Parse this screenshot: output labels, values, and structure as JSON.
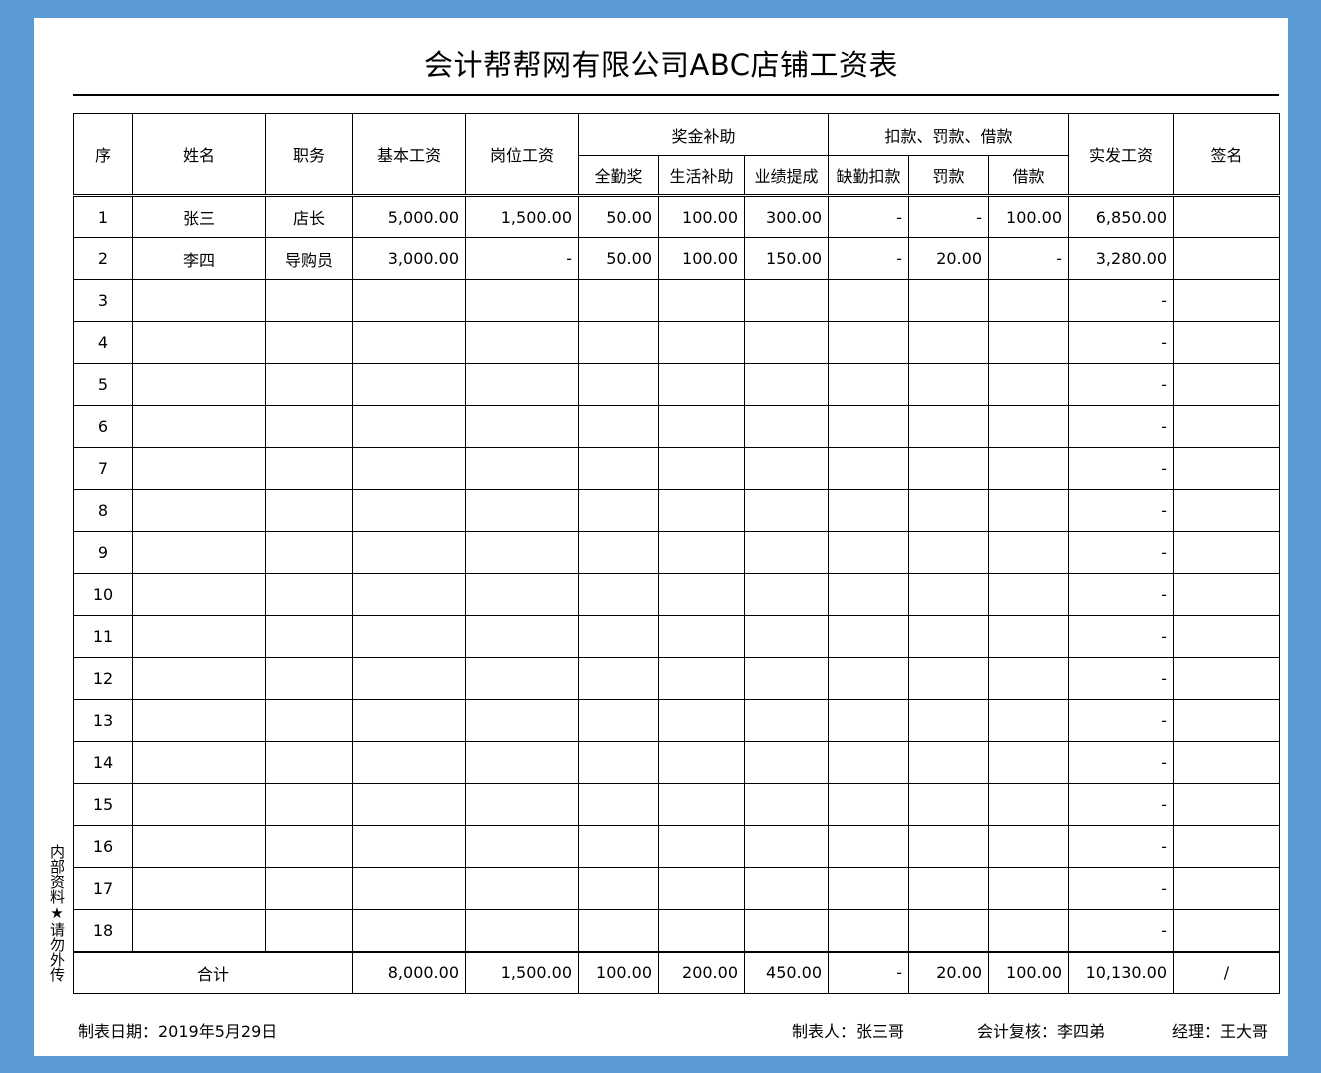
{
  "title": "会计帮帮网有限公司ABC店铺工资表",
  "side_note": "内部资料★请勿外传",
  "header": {
    "seq": "序",
    "name": "姓名",
    "position": "职务",
    "base_salary": "基本工资",
    "post_salary": "岗位工资",
    "bonus_group": "奖金补助",
    "full_attendance": "全勤奖",
    "living_allowance": "生活补助",
    "performance": "业绩提成",
    "deduct_group": "扣款、罚款、借款",
    "absence_deduction": "缺勤扣款",
    "fine": "罚款",
    "loan": "借款",
    "net_pay": "实发工资",
    "signature": "签名"
  },
  "rows": [
    {
      "seq": "1",
      "name": "张三",
      "position": "店长",
      "base": "5,000.00",
      "post": "1,500.00",
      "full": "50.00",
      "living": "100.00",
      "perf": "300.00",
      "absence": "-",
      "fine": "-",
      "loan": "100.00",
      "net": "6,850.00",
      "sign": ""
    },
    {
      "seq": "2",
      "name": "李四",
      "position": "导购员",
      "base": "3,000.00",
      "post": "-",
      "full": "50.00",
      "living": "100.00",
      "perf": "150.00",
      "absence": "-",
      "fine": "20.00",
      "loan": "-",
      "net": "3,280.00",
      "sign": ""
    },
    {
      "seq": "3",
      "name": "",
      "position": "",
      "base": "",
      "post": "",
      "full": "",
      "living": "",
      "perf": "",
      "absence": "",
      "fine": "",
      "loan": "",
      "net": "-",
      "sign": ""
    },
    {
      "seq": "4",
      "name": "",
      "position": "",
      "base": "",
      "post": "",
      "full": "",
      "living": "",
      "perf": "",
      "absence": "",
      "fine": "",
      "loan": "",
      "net": "-",
      "sign": ""
    },
    {
      "seq": "5",
      "name": "",
      "position": "",
      "base": "",
      "post": "",
      "full": "",
      "living": "",
      "perf": "",
      "absence": "",
      "fine": "",
      "loan": "",
      "net": "-",
      "sign": ""
    },
    {
      "seq": "6",
      "name": "",
      "position": "",
      "base": "",
      "post": "",
      "full": "",
      "living": "",
      "perf": "",
      "absence": "",
      "fine": "",
      "loan": "",
      "net": "-",
      "sign": ""
    },
    {
      "seq": "7",
      "name": "",
      "position": "",
      "base": "",
      "post": "",
      "full": "",
      "living": "",
      "perf": "",
      "absence": "",
      "fine": "",
      "loan": "",
      "net": "-",
      "sign": ""
    },
    {
      "seq": "8",
      "name": "",
      "position": "",
      "base": "",
      "post": "",
      "full": "",
      "living": "",
      "perf": "",
      "absence": "",
      "fine": "",
      "loan": "",
      "net": "-",
      "sign": ""
    },
    {
      "seq": "9",
      "name": "",
      "position": "",
      "base": "",
      "post": "",
      "full": "",
      "living": "",
      "perf": "",
      "absence": "",
      "fine": "",
      "loan": "",
      "net": "-",
      "sign": ""
    },
    {
      "seq": "10",
      "name": "",
      "position": "",
      "base": "",
      "post": "",
      "full": "",
      "living": "",
      "perf": "",
      "absence": "",
      "fine": "",
      "loan": "",
      "net": "-",
      "sign": ""
    },
    {
      "seq": "11",
      "name": "",
      "position": "",
      "base": "",
      "post": "",
      "full": "",
      "living": "",
      "perf": "",
      "absence": "",
      "fine": "",
      "loan": "",
      "net": "-",
      "sign": ""
    },
    {
      "seq": "12",
      "name": "",
      "position": "",
      "base": "",
      "post": "",
      "full": "",
      "living": "",
      "perf": "",
      "absence": "",
      "fine": "",
      "loan": "",
      "net": "-",
      "sign": ""
    },
    {
      "seq": "13",
      "name": "",
      "position": "",
      "base": "",
      "post": "",
      "full": "",
      "living": "",
      "perf": "",
      "absence": "",
      "fine": "",
      "loan": "",
      "net": "-",
      "sign": ""
    },
    {
      "seq": "14",
      "name": "",
      "position": "",
      "base": "",
      "post": "",
      "full": "",
      "living": "",
      "perf": "",
      "absence": "",
      "fine": "",
      "loan": "",
      "net": "-",
      "sign": ""
    },
    {
      "seq": "15",
      "name": "",
      "position": "",
      "base": "",
      "post": "",
      "full": "",
      "living": "",
      "perf": "",
      "absence": "",
      "fine": "",
      "loan": "",
      "net": "-",
      "sign": ""
    },
    {
      "seq": "16",
      "name": "",
      "position": "",
      "base": "",
      "post": "",
      "full": "",
      "living": "",
      "perf": "",
      "absence": "",
      "fine": "",
      "loan": "",
      "net": "-",
      "sign": ""
    },
    {
      "seq": "17",
      "name": "",
      "position": "",
      "base": "",
      "post": "",
      "full": "",
      "living": "",
      "perf": "",
      "absence": "",
      "fine": "",
      "loan": "",
      "net": "-",
      "sign": ""
    },
    {
      "seq": "18",
      "name": "",
      "position": "",
      "base": "",
      "post": "",
      "full": "",
      "living": "",
      "perf": "",
      "absence": "",
      "fine": "",
      "loan": "",
      "net": "-",
      "sign": ""
    }
  ],
  "total": {
    "label": "合计",
    "base": "8,000.00",
    "post": "1,500.00",
    "full": "100.00",
    "living": "200.00",
    "perf": "450.00",
    "absence": "-",
    "fine": "20.00",
    "loan": "100.00",
    "net": "10,130.00",
    "sign": "/"
  },
  "footer": {
    "date": "制表日期：2019年5月29日",
    "preparer": "制表人：张三哥",
    "reviewer": "会计复核：李四弟",
    "manager": "经理：王大哥"
  }
}
